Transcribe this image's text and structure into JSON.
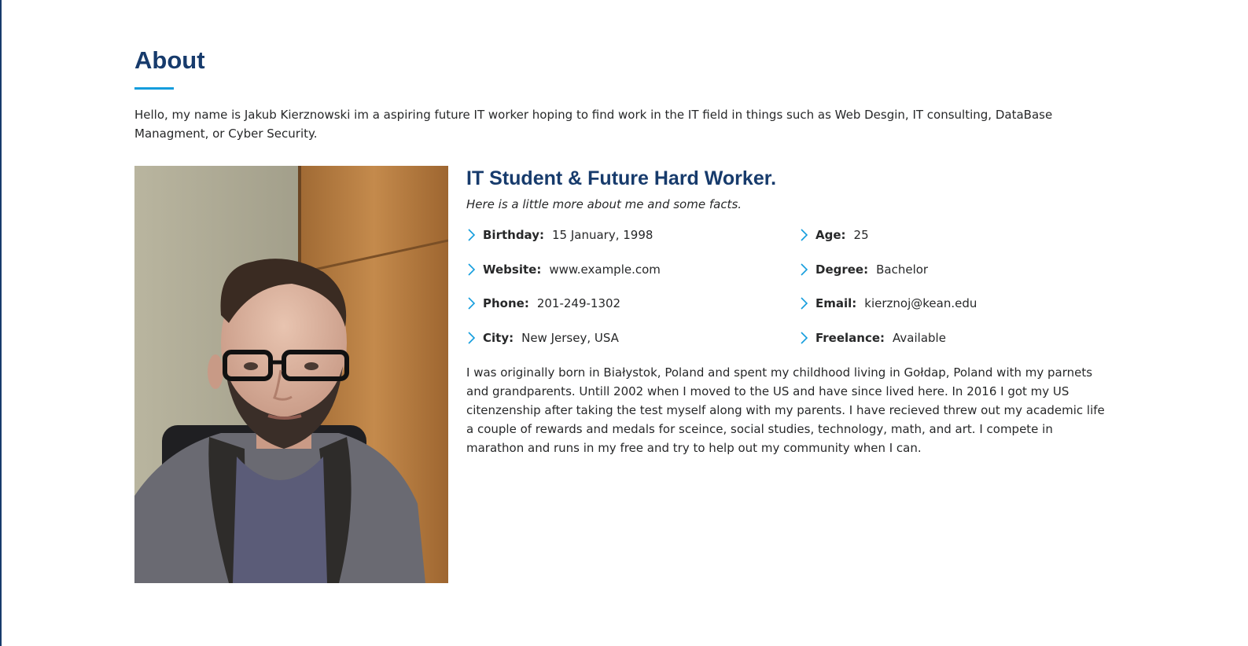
{
  "about": {
    "title": "About",
    "intro": "Hello, my name is Jakub Kierznowski im a aspiring future IT worker hoping to find work in the IT field in things such as Web Desgin, IT consulting, DataBase Managment, or Cyber Security.",
    "headline": "IT Student & Future Hard Worker.",
    "subheadline": "Here is a little more about me and some facts.",
    "facts": [
      {
        "label": "Birthday:",
        "value": "15 January, 1998"
      },
      {
        "label": "Age:",
        "value": "25"
      },
      {
        "label": "Website:",
        "value": "www.example.com"
      },
      {
        "label": "Degree:",
        "value": "Bachelor"
      },
      {
        "label": "Phone:",
        "value": "201-249-1302"
      },
      {
        "label": "Email:",
        "value": "kierznoj@kean.edu"
      },
      {
        "label": "City:",
        "value": "New Jersey, USA"
      },
      {
        "label": "Freelance:",
        "value": "Available"
      }
    ],
    "bio": "I was originally born in Białystok, Poland and spent my childhood living in Gołdap, Poland with my parnets and grandparents. Untill 2002 when I moved to the US and have since lived here. In 2016 I got my US citenzenship after taking the test myself along with my parents. I have recieved threw out my academic life a couple of rewards and medals for sceince, social studies, technology, math, and art. I compete in marathon and runs in my free and try to help out my community when I can."
  },
  "icons": {
    "fact_bullet": "chevron-right-icon",
    "photo": "profile-photo"
  },
  "colors": {
    "heading": "#173b6c",
    "accent": "#149ddd",
    "text": "#272829"
  }
}
